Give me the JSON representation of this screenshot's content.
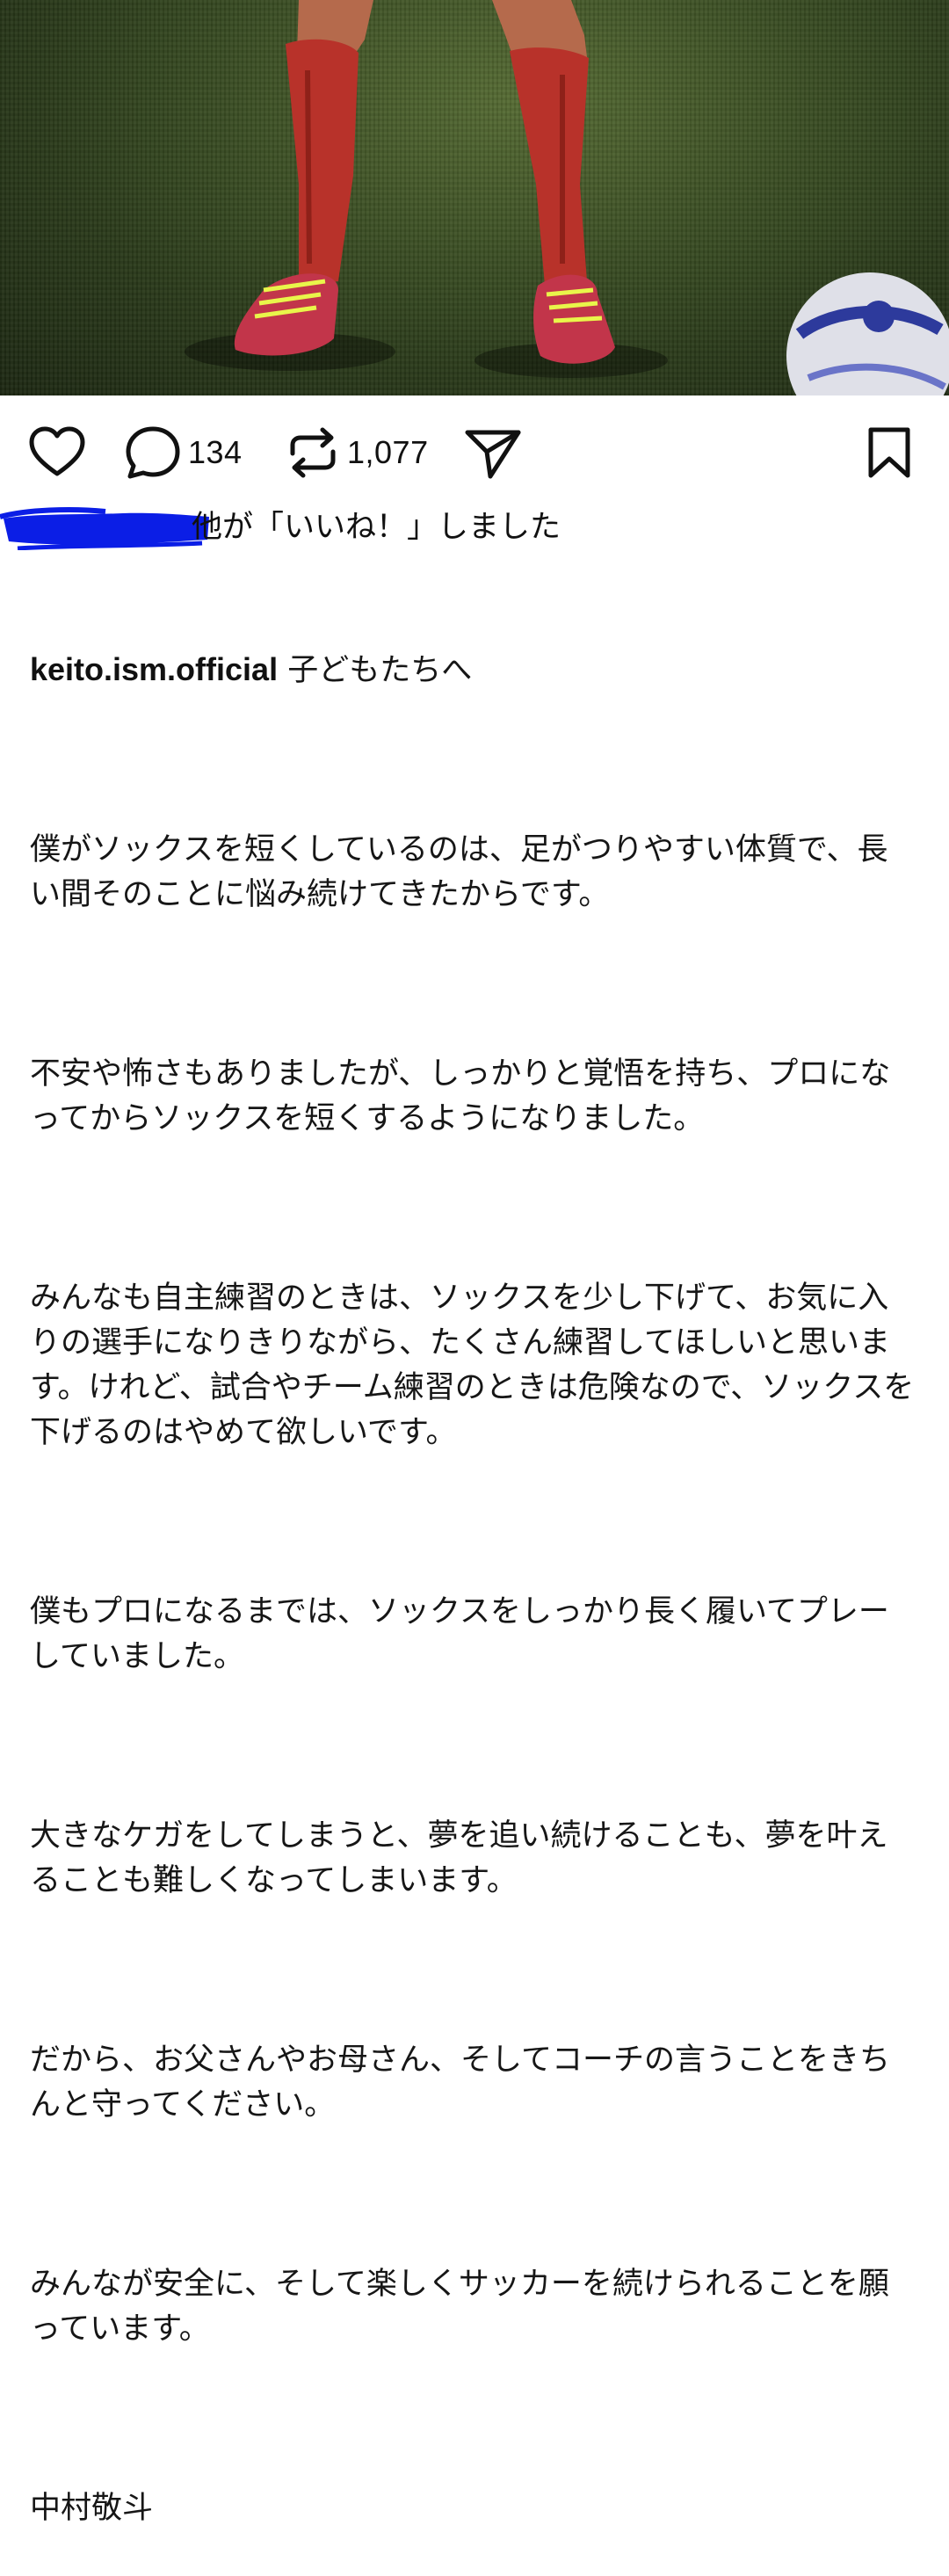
{
  "post": {
    "image_alt": "soccer player red socks and red cleats on grass field with a ball"
  },
  "actions": {
    "comments_count": "134",
    "reposts_count": "1,077"
  },
  "liked_by": {
    "text": "他が「いいね！」しました"
  },
  "caption": {
    "username": "keito.ism.official",
    "first_line": "子どもたちへ",
    "paragraphs": [
      "僕がソックスを短くしているのは、足がつりやすい体質で、長い間そのことに悩み続けてきたからです。",
      "不安や怖さもありましたが、しっかりと覚悟を持ち、プロになってからソックスを短くするようになりました。",
      "みんなも自主練習のときは、ソックスを少し下げて、お気に入りの選手になりきりながら、たくさん練習してほしいと思います。けれど、試合やチーム練習のときは危険なので、ソックスを下げるのはやめて欲しいです。",
      "僕もプロになるまでは、ソックスをしっかり長く履いてプレーしていました。",
      "大きなケガをしてしまうと、夢を追い続けることも、夢を叶えることも難しくなってしまいます。",
      "だから、お父さんやお母さん、そしてコーチの言うことをきちんと守ってください。",
      "みんなが安全に、そして楽しくサッカーを続けられることを願っています。",
      "中村敬斗"
    ]
  },
  "icons": {
    "like": "heart-icon",
    "comment": "speech-bubble-icon",
    "repost": "repost-arrows-icon",
    "share": "paper-plane-icon",
    "save": "bookmark-icon"
  },
  "colors": {
    "sock_red": "#b8322a",
    "grass": "#3d5125",
    "scribble": "#0b1ee6"
  }
}
